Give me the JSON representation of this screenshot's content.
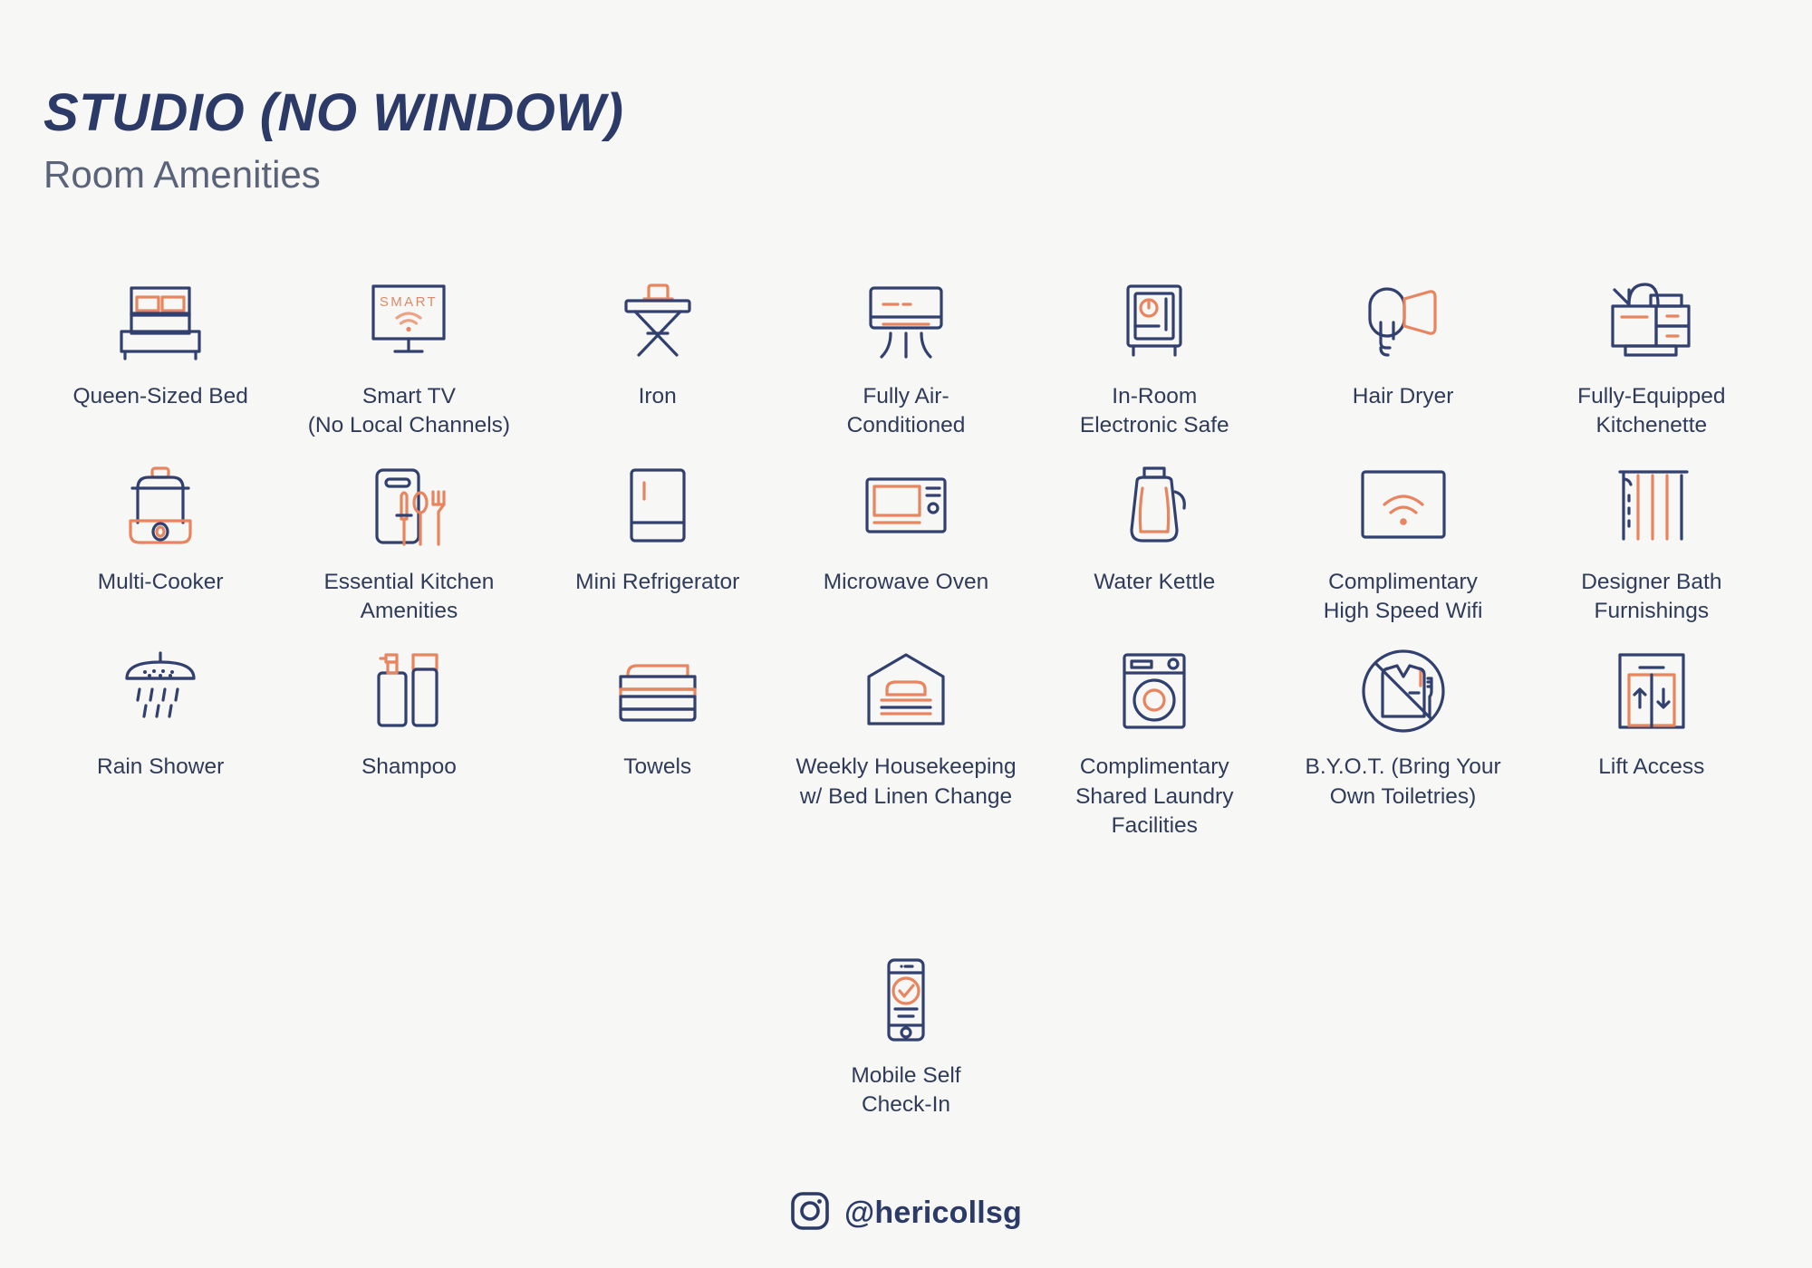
{
  "header": {
    "title": "STUDIO (NO WINDOW)",
    "subtitle": "Room Amenities"
  },
  "colors": {
    "background": "#f7f7f6",
    "navy": "#31406e",
    "title_navy": "#2b3a67",
    "label_navy": "#2f3b58",
    "subtitle_grey": "#5a6378",
    "orange": "#e8855f",
    "orange_light": "#eda184"
  },
  "amenities": [
    {
      "label": "Queen-Sized Bed",
      "icon": "bed-icon"
    },
    {
      "label": "Smart TV\n(No Local Channels)",
      "icon": "smart-tv-icon",
      "screen_text": "SMART"
    },
    {
      "label": "Iron",
      "icon": "iron-board-icon"
    },
    {
      "label": "Fully Air-\nConditioned",
      "icon": "air-conditioner-icon"
    },
    {
      "label": "In-Room\nElectronic Safe",
      "icon": "safe-icon"
    },
    {
      "label": "Hair Dryer",
      "icon": "hair-dryer-icon"
    },
    {
      "label": "Fully-Equipped\nKitchenette",
      "icon": "kitchenette-icon"
    },
    {
      "label": "Multi-Cooker",
      "icon": "multi-cooker-icon"
    },
    {
      "label": "Essential Kitchen\nAmenities",
      "icon": "cutting-board-cutlery-icon"
    },
    {
      "label": "Mini Refrigerator",
      "icon": "refrigerator-icon"
    },
    {
      "label": "Microwave Oven",
      "icon": "microwave-icon"
    },
    {
      "label": "Water Kettle",
      "icon": "kettle-icon"
    },
    {
      "label": "Complimentary\nHigh Speed Wifi",
      "icon": "wifi-icon"
    },
    {
      "label": "Designer Bath\nFurnishings",
      "icon": "shower-curtain-icon"
    },
    {
      "label": "Rain Shower",
      "icon": "rain-shower-icon"
    },
    {
      "label": "Shampoo",
      "icon": "shampoo-bottles-icon"
    },
    {
      "label": "Towels",
      "icon": "towels-icon"
    },
    {
      "label": "Weekly Housekeeping\nw/ Bed Linen Change",
      "icon": "housekeeping-bed-icon"
    },
    {
      "label": "Complimentary\nShared Laundry\nFacilities",
      "icon": "washing-machine-icon"
    },
    {
      "label": "B.Y.O.T. (Bring Your\nOwn Toiletries)",
      "icon": "no-toiletries-icon"
    },
    {
      "label": "Lift Access",
      "icon": "lift-icon"
    }
  ],
  "last_item": {
    "label": "Mobile Self\nCheck-In",
    "icon": "mobile-checkin-icon"
  },
  "footer": {
    "icon": "instagram-icon",
    "handle": "@hericollsg"
  }
}
